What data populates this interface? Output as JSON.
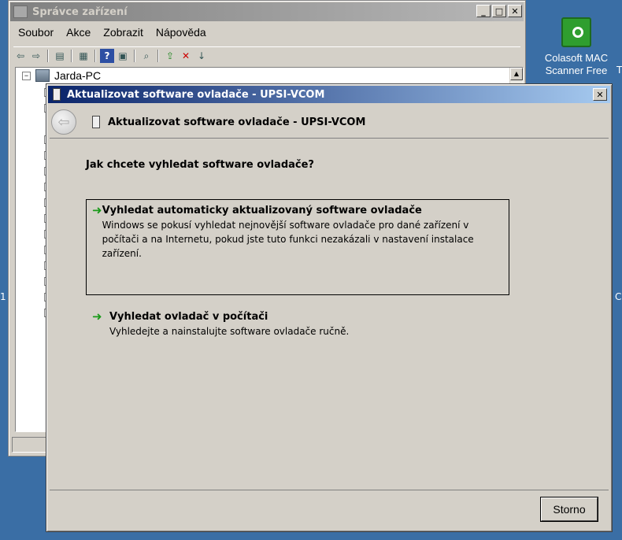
{
  "device_manager": {
    "title": "Správce zařízení",
    "menu": [
      "Soubor",
      "Akce",
      "Zobrazit",
      "Nápověda"
    ],
    "tree_root": "Jarda-PC",
    "window_buttons": {
      "minimize": "_",
      "maximize": "□",
      "close": "✕"
    }
  },
  "desktop_icon": {
    "label_line1": "Colasoft MAC",
    "label_line2": "Scanner Free"
  },
  "dialog": {
    "window_title": "Aktualizovat software ovladače - UPSI-VCOM",
    "header_title": "Aktualizovat software ovladače - UPSI-VCOM",
    "close_label": "✕",
    "question": "Jak chcete vyhledat software ovladače?",
    "option_auto": {
      "title": "Vyhledat automaticky aktualizovaný software ovladače",
      "description": "Windows se pokusí vyhledat nejnovější software ovladače pro dané zařízení v počítači a na Internetu, pokud jste tuto funkci nezakázali v nastavení instalace zařízení."
    },
    "option_browse": {
      "title": "Vyhledat ovladač v počítači",
      "description": "Vyhledejte a nainstalujte software ovladače ručně."
    },
    "cancel_label": "Storno"
  },
  "colors": {
    "desktop": "#3a6ea5",
    "active_title": "#0a246a",
    "arrow_green": "#1a9a1a"
  }
}
